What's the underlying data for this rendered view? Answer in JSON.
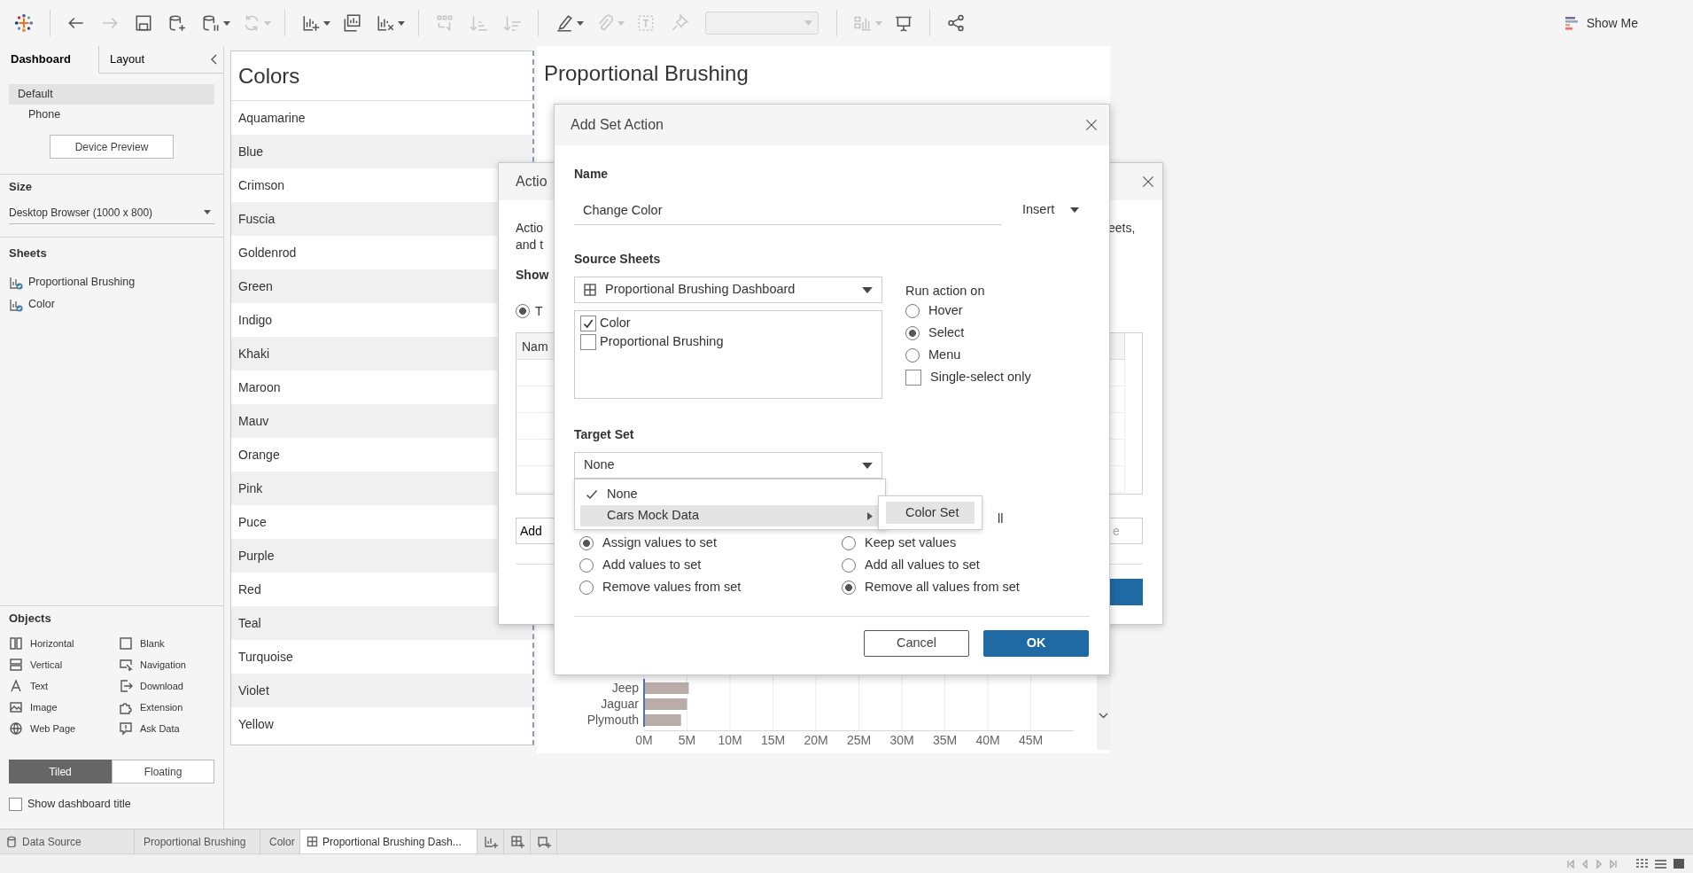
{
  "toolbar": {
    "items": [
      {
        "kind": "logo"
      },
      {
        "kind": "separator"
      },
      {
        "kind": "back",
        "disabled": false
      },
      {
        "kind": "forward",
        "disabled": true
      },
      {
        "kind": "save",
        "disabled": false
      },
      {
        "kind": "datasource_add",
        "disabled": false
      },
      {
        "kind": "pause",
        "disabled": false,
        "dropdown": true
      },
      {
        "kind": "refresh",
        "disabled": true,
        "dropdown": true
      },
      {
        "kind": "separator"
      },
      {
        "kind": "sheet_add",
        "disabled": false,
        "dropdown": true
      },
      {
        "kind": "duplicate",
        "disabled": false
      },
      {
        "kind": "clear",
        "disabled": false,
        "dropdown": true
      },
      {
        "kind": "separator"
      },
      {
        "kind": "swap",
        "disabled": true
      },
      {
        "kind": "sort_asc",
        "disabled": true
      },
      {
        "kind": "sort_desc",
        "disabled": true
      },
      {
        "kind": "separator"
      },
      {
        "kind": "pen",
        "disabled": false,
        "dropdown": true
      },
      {
        "kind": "paperclip",
        "disabled": true,
        "dropdown": true
      },
      {
        "kind": "textbox",
        "disabled": true
      },
      {
        "kind": "pin",
        "disabled": true
      },
      {
        "kind": "field",
        "disabled": true
      },
      {
        "kind": "separator"
      },
      {
        "kind": "cards",
        "disabled": true,
        "dropdown": true
      },
      {
        "kind": "presentation",
        "disabled": false
      },
      {
        "kind": "separator"
      },
      {
        "kind": "share",
        "disabled": false
      }
    ]
  },
  "show_me": {
    "label": "Show Me"
  },
  "side_panel": {
    "tabs": [
      {
        "label": "Dashboard",
        "selected": true
      },
      {
        "label": "Layout",
        "selected": false
      }
    ],
    "devices": [
      {
        "label": "Default",
        "selected": true,
        "children": [
          {
            "label": "Phone",
            "selected": false
          }
        ]
      }
    ],
    "device_preview_button": "Device Preview",
    "size": {
      "title": "Size",
      "value": "Desktop Browser (1000 x 800)"
    },
    "sheets": {
      "title": "Sheets",
      "items": [
        "Proportional Brushing",
        "Color"
      ]
    },
    "objects": {
      "title": "Objects",
      "items": [
        {
          "label": "Horizontal",
          "kind": "horizontal"
        },
        {
          "label": "Blank",
          "kind": "blank"
        },
        {
          "label": "Vertical",
          "kind": "vertical"
        },
        {
          "label": "Navigation",
          "kind": "navigation"
        },
        {
          "label": "Text",
          "kind": "text"
        },
        {
          "label": "Download",
          "kind": "download"
        },
        {
          "label": "Image",
          "kind": "image"
        },
        {
          "label": "Extension",
          "kind": "extension"
        },
        {
          "label": "Web Page",
          "kind": "web_page"
        },
        {
          "label": "Ask Data",
          "kind": "ask_data"
        }
      ]
    },
    "layout_modes": [
      {
        "label": "Tiled",
        "selected": true
      },
      {
        "label": "Floating",
        "selected": false
      }
    ],
    "show_title": {
      "label": "Show dashboard title",
      "checked": false
    }
  },
  "colors_sheet": {
    "title": "Colors",
    "items": [
      "Aquamarine",
      "Blue",
      "Crimson",
      "Fuscia",
      "Goldenrod",
      "Green",
      "Indigo",
      "Khaki",
      "Maroon",
      "Mauv",
      "Orange",
      "Pink",
      "Puce",
      "Purple",
      "Red",
      "Teal",
      "Turquoise",
      "Violet",
      "Yellow"
    ]
  },
  "brushing_sheet": {
    "title": "Proportional Brushing",
    "chart_data": {
      "type": "bar",
      "orientation": "horizontal",
      "categories": [
        "Jeep",
        "Jaguar",
        "Plymouth"
      ],
      "values": [
        5.1,
        4.9,
        4.2
      ],
      "grid": true,
      "xlim": [
        0,
        50
      ],
      "xticks": [
        {
          "value": 0,
          "label": "0M"
        },
        {
          "value": 5,
          "label": "5M"
        },
        {
          "value": 10,
          "label": "10M"
        },
        {
          "value": 15,
          "label": "15M"
        },
        {
          "value": 20,
          "label": "20M"
        },
        {
          "value": 25,
          "label": "25M"
        },
        {
          "value": 30,
          "label": "30M"
        },
        {
          "value": 35,
          "label": "35M"
        },
        {
          "value": 40,
          "label": "40M"
        },
        {
          "value": 45,
          "label": "45M"
        }
      ]
    }
  },
  "actions_dialog": {
    "title": "Actio",
    "description_left": [
      "Actio",
      "and t"
    ],
    "description_right": "eets,",
    "show_label": "Show",
    "show_option": {
      "label": "T",
      "selected": true
    },
    "table_header": "Nam",
    "add_button": "Add",
    "right_button": "e"
  },
  "set_action_dialog": {
    "title": "Add Set Action",
    "name_label": "Name",
    "name_value": "Change Color",
    "insert_label": "Insert",
    "source_label": "Source Sheets",
    "source_value": "Proportional Brushing Dashboard",
    "source_sheets": [
      {
        "label": "Color",
        "checked": true
      },
      {
        "label": "Proportional Brushing",
        "checked": false
      }
    ],
    "run_label": "Run action on",
    "run_options": [
      {
        "label": "Hover",
        "selected": false
      },
      {
        "label": "Select",
        "selected": true
      },
      {
        "label": "Menu",
        "selected": false
      }
    ],
    "single_select": {
      "label": "Single-select only",
      "checked": false
    },
    "target_label": "Target Set",
    "target_value": "None",
    "target_menu": [
      {
        "label": "None",
        "selected": true,
        "highlighted": false,
        "has_submenu": false
      },
      {
        "label": "Cars Mock Data",
        "selected": false,
        "highlighted": true,
        "has_submenu": true
      }
    ],
    "submenu": [
      {
        "label": "Color Set",
        "highlighted": true
      }
    ],
    "hidden_heading_fragment": "ll",
    "running_options": [
      {
        "label": "Assign values to set",
        "selected": true
      },
      {
        "label": "Add values to set",
        "selected": false
      },
      {
        "label": "Remove values from set",
        "selected": false
      }
    ],
    "clearing_options": [
      {
        "label": "Keep set values",
        "selected": false
      },
      {
        "label": "Add all values to set",
        "selected": false
      },
      {
        "label": "Remove all values from set",
        "selected": true
      }
    ],
    "buttons": [
      {
        "label": "Cancel",
        "kind": "secondary"
      },
      {
        "label": "OK",
        "kind": "primary"
      }
    ]
  },
  "sheet_tabs": [
    {
      "label": "Data Source",
      "kind": "datasource",
      "selected": false
    },
    {
      "label": "Proportional Brushing",
      "kind": "worksheet",
      "selected": false
    },
    {
      "label": "Color",
      "kind": "worksheet",
      "selected": false
    },
    {
      "label": "Proportional Brushing Dash...",
      "kind": "dashboard",
      "selected": true
    }
  ]
}
